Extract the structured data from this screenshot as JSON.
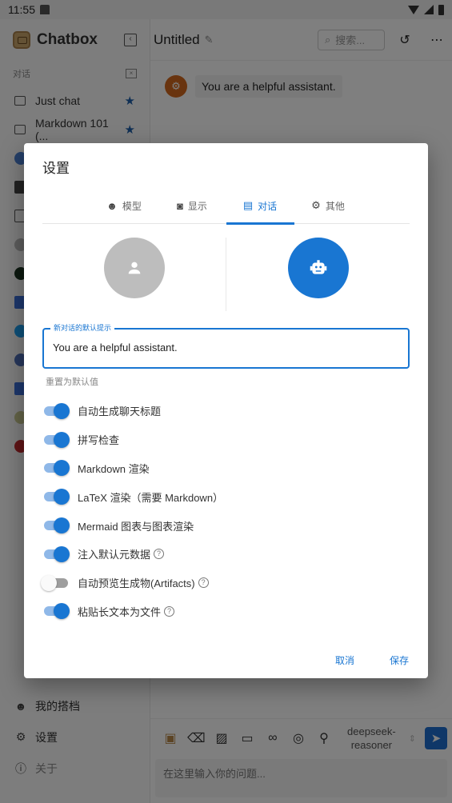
{
  "status_bar": {
    "time": "11:55"
  },
  "sidebar": {
    "app_name": "Chatbox",
    "section_label": "对话",
    "conversations": [
      {
        "label": "Just chat",
        "starred": true
      },
      {
        "label": "Markdown 101 (...",
        "starred": true
      }
    ],
    "bottom_items": [
      {
        "label": "我的搭档",
        "icon": "robot-icon"
      },
      {
        "label": "设置",
        "icon": "gear-icon"
      },
      {
        "label": "关于",
        "icon": "info-icon"
      }
    ]
  },
  "main": {
    "title": "Untitled",
    "search_placeholder": "搜索...",
    "messages": [
      {
        "role": "system",
        "text": "You are a helpful assistant."
      }
    ],
    "composer": {
      "model": [
        "deepseek-",
        "reasoner"
      ],
      "placeholder": "在这里输入你的问题..."
    }
  },
  "dialog": {
    "title": "设置",
    "tabs": [
      {
        "label": "模型",
        "icon": "robot-icon",
        "active": false
      },
      {
        "label": "显示",
        "icon": "display-icon",
        "active": false
      },
      {
        "label": "对话",
        "icon": "chat-icon",
        "active": true
      },
      {
        "label": "其他",
        "icon": "gear-icon",
        "active": false
      }
    ],
    "prompt_field": {
      "label": "新对话的默认提示",
      "value": "You are a helpful assistant."
    },
    "reset_label": "重置为默认值",
    "toggles": [
      {
        "label": "自动生成聊天标题",
        "on": true,
        "help": false
      },
      {
        "label": "拼写检查",
        "on": true,
        "help": false
      },
      {
        "label": "Markdown 渲染",
        "on": true,
        "help": false
      },
      {
        "label": "LaTeX 渲染（需要 Markdown）",
        "on": true,
        "help": false
      },
      {
        "label": "Mermaid 图表与图表渲染",
        "on": true,
        "help": false
      },
      {
        "label": "注入默认元数据",
        "on": true,
        "help": true
      },
      {
        "label": "自动预览生成物(Artifacts)",
        "on": false,
        "help": true
      },
      {
        "label": "粘贴长文本为文件",
        "on": true,
        "help": true
      }
    ],
    "cancel_label": "取消",
    "save_label": "保存"
  }
}
